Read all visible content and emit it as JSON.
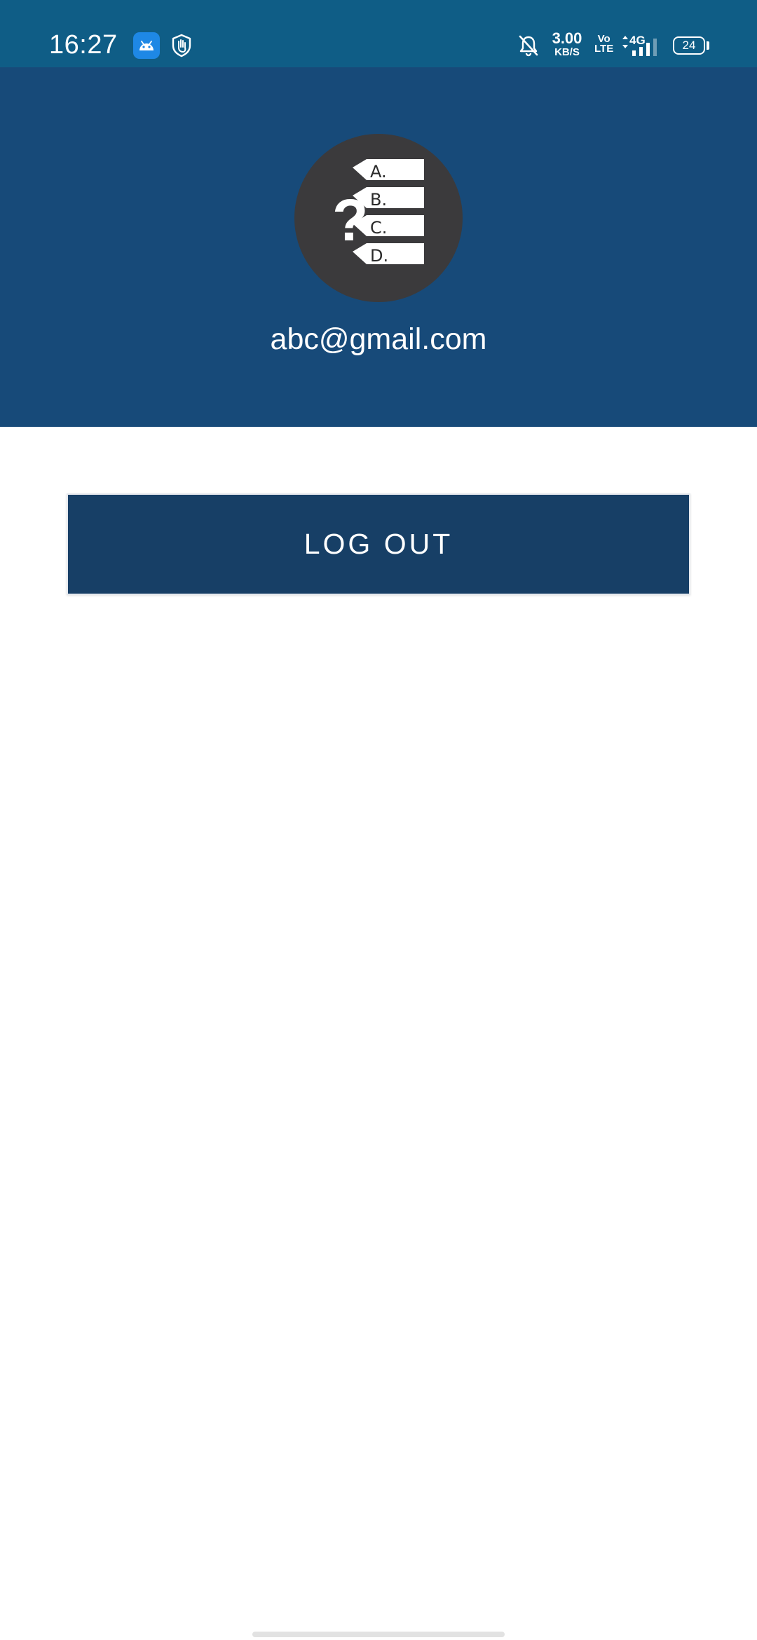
{
  "status_bar": {
    "time": "16:27",
    "net_speed_value": "3.00",
    "net_speed_unit": "KB/S",
    "volte_top": "Vo",
    "volte_bottom": "LTE",
    "network_type": "4G",
    "battery_level": "24",
    "icons": {
      "app_notification": "android-icon",
      "app_notification_2": "shield-hand-icon",
      "silent": "bell-off-icon",
      "signal": "signal-bars-icon",
      "battery": "battery-icon"
    },
    "colors": {
      "background": "#0f5d86",
      "app_icon_bg": "#1e88e5"
    }
  },
  "header": {
    "logo": "quiz-logo-icon",
    "logo_options": [
      "A.",
      "B.",
      "C.",
      "D."
    ],
    "logo_question_mark": "?",
    "email": "abc@gmail.com",
    "colors": {
      "background": "#174a79",
      "logo_circle": "#3b3a3c"
    }
  },
  "actions": {
    "logout_label": "LOG OUT",
    "colors": {
      "button_bg": "#173f66"
    }
  }
}
